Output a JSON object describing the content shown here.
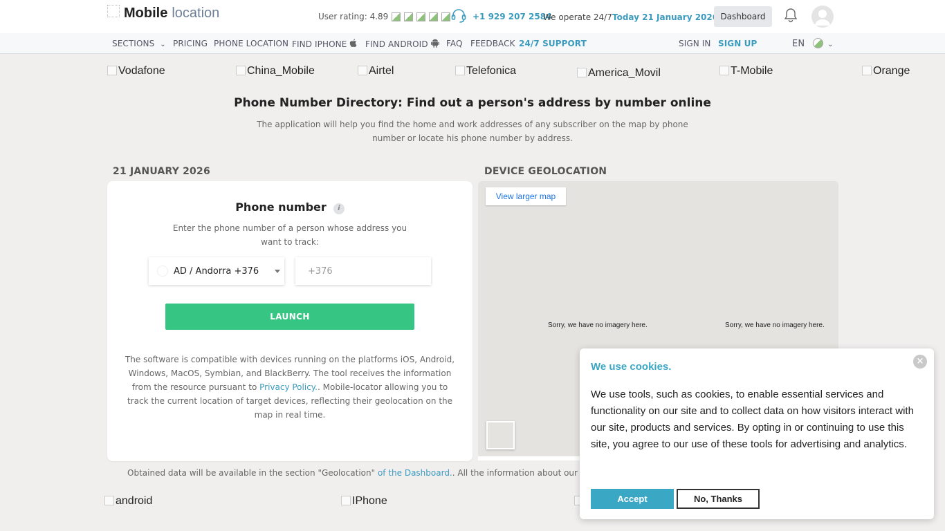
{
  "header": {
    "logo_bold": "Mobile",
    "logo_light": "location",
    "rating_label": "User rating: 4.89",
    "phone": "+1 929 207 2584",
    "operate": "We operate 24/7",
    "today": "Today 21 January 2026",
    "dashboard": "Dashboard"
  },
  "nav": {
    "sections": "SECTIONS",
    "pricing": "PRICING",
    "phone_location": "PHONE LOCATION",
    "find_iphone": "FIND IPHONE",
    "find_android": "FIND ANDROID",
    "faq": "FAQ",
    "feedback": "FEEDBACK",
    "support": "24/7 SUPPORT",
    "sign_in": "SIGN IN",
    "sign_up": "SIGN UP",
    "lang": "EN"
  },
  "operators": [
    "Vodafone",
    "China_Mobile",
    "Airtel",
    "Telefonica",
    "America_Movil",
    "T-Mobile",
    "Orange"
  ],
  "hero": {
    "title": "Phone Number Directory: Find out a person's address by number online",
    "subtitle": "The application will help you find the home and work addresses of any subscriber on the map by phone number or locate his phone number by address."
  },
  "sections": {
    "date": "21 JANUARY 2026",
    "geo": "DEVICE GEOLOCATION"
  },
  "form": {
    "title": "Phone number",
    "info": "i",
    "subtitle": "Enter the phone number of a person whose address you want to track:",
    "country": "AD / Andorra +376",
    "phone_placeholder": "+376",
    "launch": "LAUNCH",
    "text_before": "The software is compatible with devices running on the platforms iOS, Android, Windows, MacOS, Symbian, and BlackBerry. The tool receives the information from the resource pursuant to ",
    "privacy_link": "Privacy Policy.",
    "text_after": ". Mobile-locator allowing you to track the current location of target devices, reflecting their geolocation on the map in real time."
  },
  "map": {
    "larger": "View larger map",
    "sorry": "Sorry, we have no imagery here."
  },
  "footer_note": {
    "before": "Obtained data will be available in the section \"Geolocation\" ",
    "link": "of the Dashboard.",
    "after": ". All the information about our cust"
  },
  "os_images": [
    "android",
    "IPhone"
  ],
  "cookie": {
    "title": "We use cookies.",
    "close": "×",
    "text": "We use tools, such as cookies, to enable essential services and functionality on our site and to collect data on how visitors interact with our site, products and services. By opting in or continuing to use this site, you agree to our use of these tools for advertising and analytics.",
    "accept": "Accept",
    "decline": "No, Thanks"
  },
  "colors": {
    "accent": "#3a9bbf",
    "launch": "#37c584",
    "cookie_accent": "#3aa7c4"
  }
}
